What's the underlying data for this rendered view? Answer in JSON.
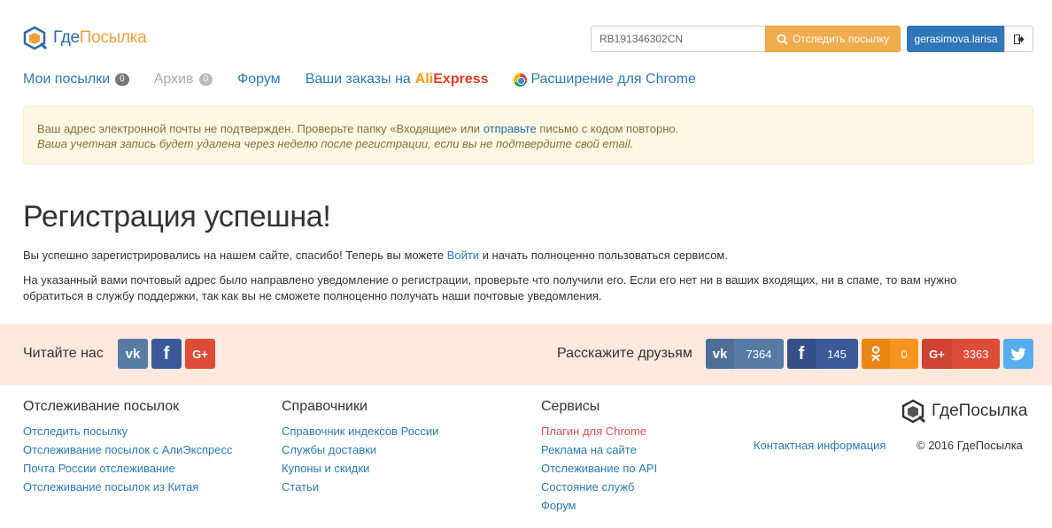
{
  "header": {
    "logo_blue": "Где",
    "logo_orange": "Посылка",
    "track_value": "RB191346302CN",
    "track_button": "Отследить посылку",
    "username": "gerasimova.larisa"
  },
  "nav": {
    "my_parcels": "Мои посылки",
    "my_parcels_count": "0",
    "archive": "Архив",
    "archive_count": "0",
    "forum": "Форум",
    "orders_prefix": "Ваши заказы на",
    "ali": "Ali",
    "express": "Express",
    "chrome_ext": "Расширение для Chrome"
  },
  "alert": {
    "line1_before": "Ваш адрес электронной почты не подтвержден. Проверьте папку «Входящие» или",
    "line1_link": "отправьте",
    "line1_after": "письмо с кодом повторно.",
    "line2": "Ваша учетная запись будет удалена через неделю после регистрации, если вы не подтвердите свой email."
  },
  "main": {
    "title": "Регистрация успешна!",
    "p1_before": "Вы успешно зарегистрировались на нашем сайте, спасибо! Теперь вы можете",
    "p1_link": "Войти",
    "p1_after": "и начать полноценно пользоваться сервисом.",
    "p2": "На указанный вами почтовый адрес было направлено уведомление о регистрации, проверьте что получили его. Если его нет ни в ваших входящих, ни в спаме, то вам нужно обратиться в службу поддержки, так как вы не сможете полноценно получать наши почтовые уведомления."
  },
  "social": {
    "read_us": "Читайте нас",
    "tell_friends": "Расскажите друзьям",
    "vk_count": "7364",
    "fb_count": "145",
    "ok_count": "0",
    "gplus_count": "3363",
    "colors": {
      "vk": "#587ba6",
      "fb": "#3b5998",
      "gplus": "#dd4b39",
      "ok": "#f7931e",
      "tw": "#55acee"
    }
  },
  "footer": {
    "col1": {
      "title": "Отслеживание посылок",
      "links": [
        "Отследить посылку",
        "Отслеживание посылок с АлиЭкспресс",
        "Почта России отслеживание",
        "Отслеживание посылок из Китая"
      ]
    },
    "col2": {
      "title": "Справочники",
      "links": [
        "Справочник индексов России",
        "Службы доставки",
        "Купоны и скидки",
        "Статьи"
      ]
    },
    "col3": {
      "title": "Сервисы",
      "links": [
        "Плагин для Chrome",
        "Реклама на сайте",
        "Отслеживание по API",
        "Состояние служб",
        "Форум"
      ]
    },
    "logo_text": "ГдеПосылка",
    "contact": "Контактная информация",
    "copyright": "© 2016 ГдеПосылка"
  }
}
